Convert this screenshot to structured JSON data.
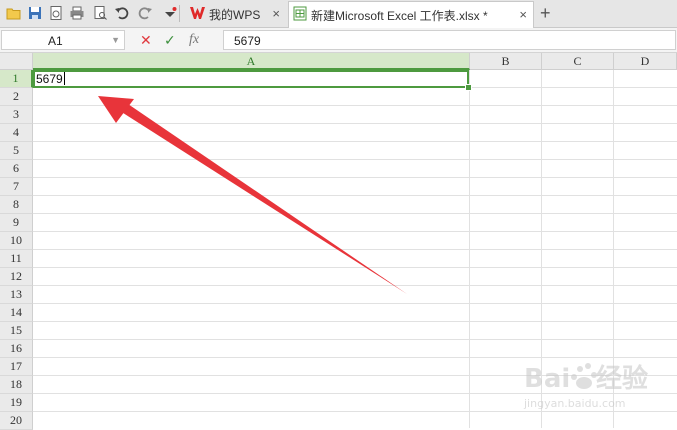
{
  "titlebar": {
    "tabs": [
      {
        "label": "我的WPS",
        "close": "×"
      },
      {
        "label": "新建Microsoft Excel 工作表.xlsx *",
        "close": "×"
      }
    ],
    "new_tab": "+"
  },
  "formula_bar": {
    "cell_ref": "A1",
    "cancel": "✕",
    "confirm": "✓",
    "fx": "fx",
    "value": "5679"
  },
  "sheet": {
    "columns": [
      "A",
      "B",
      "C",
      "D"
    ],
    "rows": [
      "1",
      "2",
      "3",
      "4",
      "5",
      "6",
      "7",
      "8",
      "9",
      "10",
      "11",
      "12",
      "13",
      "14",
      "15",
      "16",
      "17",
      "18",
      "19",
      "20"
    ],
    "active_cell_text": "5679"
  },
  "colors": {
    "accent_green": "#4d9a3f",
    "wps_red": "#e02a2a",
    "annotation_red": "#e8343a"
  }
}
